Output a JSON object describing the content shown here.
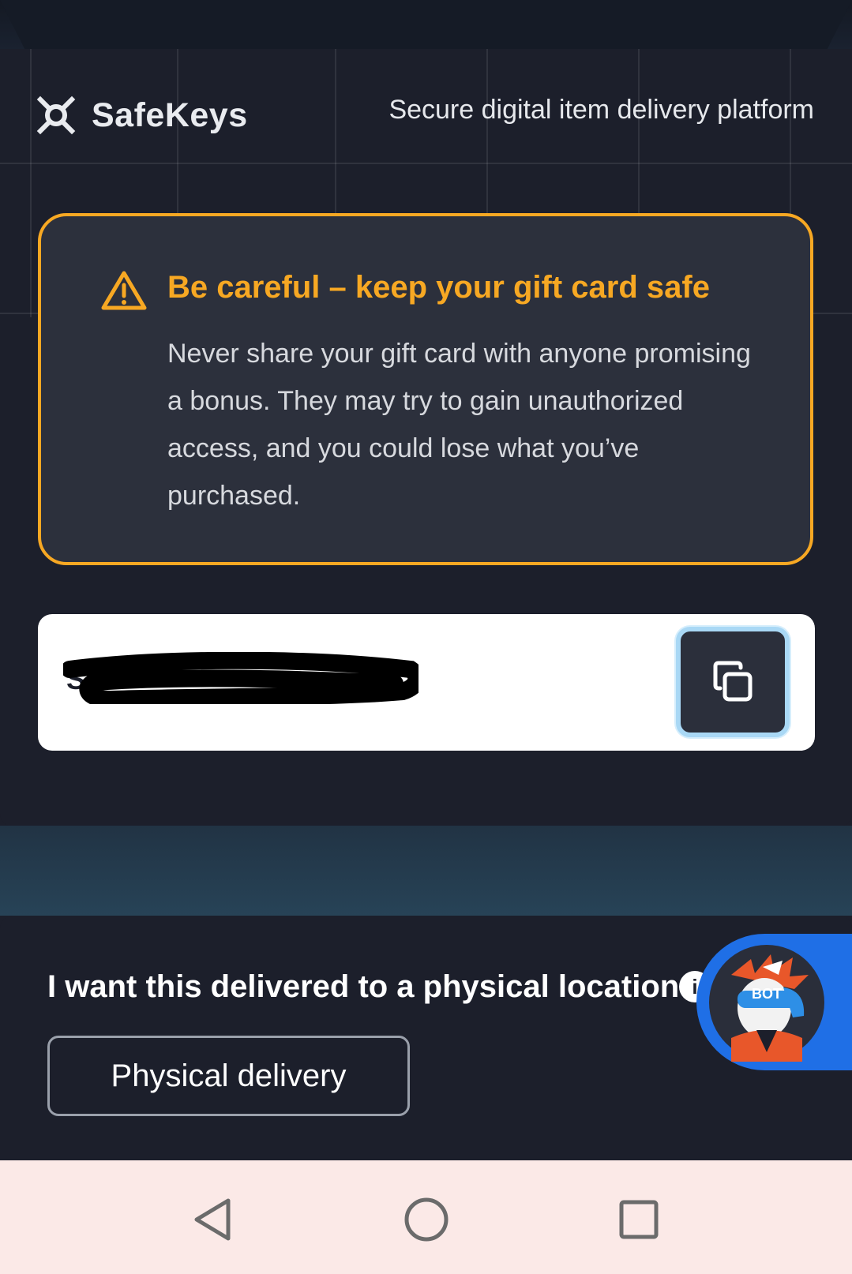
{
  "brand": {
    "name": "SafeKeys",
    "tagline": "Secure digital item delivery platform",
    "logo_icon": "safekeys-logo-icon"
  },
  "warning": {
    "title": "Be careful – keep your gift card safe",
    "body": "Never share your gift card with anyone promising a bonus. They may try to gain unauthorized access, and you could lose what you’ve purchased.",
    "accent_color": "#f7a823",
    "icon": "warning-triangle-icon"
  },
  "code": {
    "visible_fragment": "S",
    "redacted": true,
    "copy_icon": "copy-icon"
  },
  "delivery": {
    "title": "I want this delivered to a physical location",
    "info_icon": "info-icon",
    "button_label": "Physical delivery"
  },
  "bot": {
    "label": "BOT",
    "accent_color": "#1f6fe6"
  },
  "navigation": {
    "back_icon": "back-triangle-icon",
    "home_icon": "home-circle-icon",
    "recents_icon": "recents-square-icon"
  }
}
